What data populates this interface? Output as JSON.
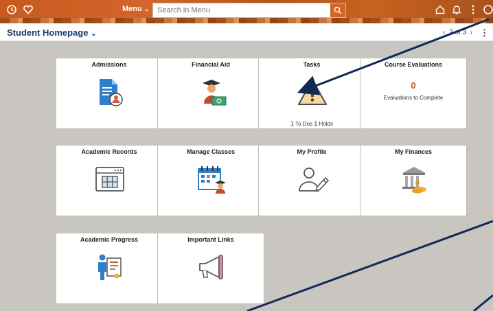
{
  "topbar": {
    "recent_icon": "clock-icon",
    "favorites_icon": "heart-icon",
    "menu_label": "Menu",
    "search_placeholder": "Search in Menu",
    "home_icon": "home-icon",
    "notifications_icon": "bell-icon"
  },
  "header": {
    "title": "Student Homepage",
    "pager": "2 of 3"
  },
  "tiles": {
    "admissions": {
      "title": "Admissions"
    },
    "financial_aid": {
      "title": "Financial Aid"
    },
    "tasks": {
      "title": "Tasks",
      "todo_count": "1",
      "todo_label": "To Dos",
      "holds_count": "1",
      "holds_label": "Holds"
    },
    "course_evaluations": {
      "title": "Course Evaluations",
      "count": "0",
      "label": "Evaluations to Complete"
    },
    "academic_records": {
      "title": "Academic Records"
    },
    "manage_classes": {
      "title": "Manage Classes"
    },
    "my_profile": {
      "title": "My Profile"
    },
    "my_finances": {
      "title": "My Finances"
    },
    "academic_progress": {
      "title": "Academic Progress"
    },
    "important_links": {
      "title": "Important Links"
    }
  },
  "colors": {
    "brand": "#c75a1e",
    "title_blue": "#1a3a6b",
    "arrow": "#0f2a55",
    "background": "#c9c6c2"
  }
}
